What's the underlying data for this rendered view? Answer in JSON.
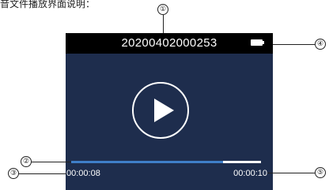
{
  "page_heading": "音文件播放界面说明：",
  "screen": {
    "file_name": "20200402000253",
    "battery_icon": "battery-full-icon",
    "play_icon": "play-icon",
    "progress_fraction": 0.8,
    "elapsed_time": "00:00:08",
    "total_time": "00:00:10"
  },
  "callouts": [
    "①",
    "②",
    "③",
    "④",
    "⑤"
  ]
}
